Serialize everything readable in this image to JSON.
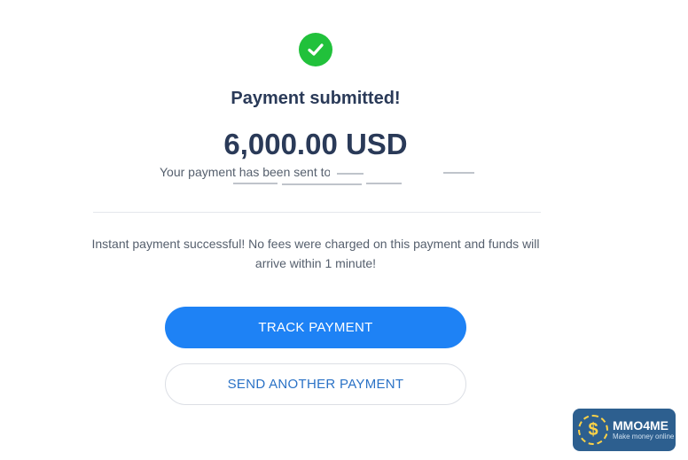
{
  "status": {
    "icon": "check-circle-icon",
    "title": "Payment submitted!",
    "amount": "6,000.00 USD",
    "sent_message": "Your payment has been sent to"
  },
  "info_message": "Instant payment successful! No fees were charged on this payment and funds will arrive within 1 minute!",
  "actions": {
    "track_label": "TRACK PAYMENT",
    "send_another_label": "SEND ANOTHER PAYMENT"
  },
  "watermark": {
    "name": "MMO4ME",
    "tagline": "Make money online"
  },
  "colors": {
    "success": "#21c13b",
    "primary_button": "#1e82f5",
    "heading_text": "#2a3a58",
    "secondary_button_text": "#2a72c6"
  }
}
